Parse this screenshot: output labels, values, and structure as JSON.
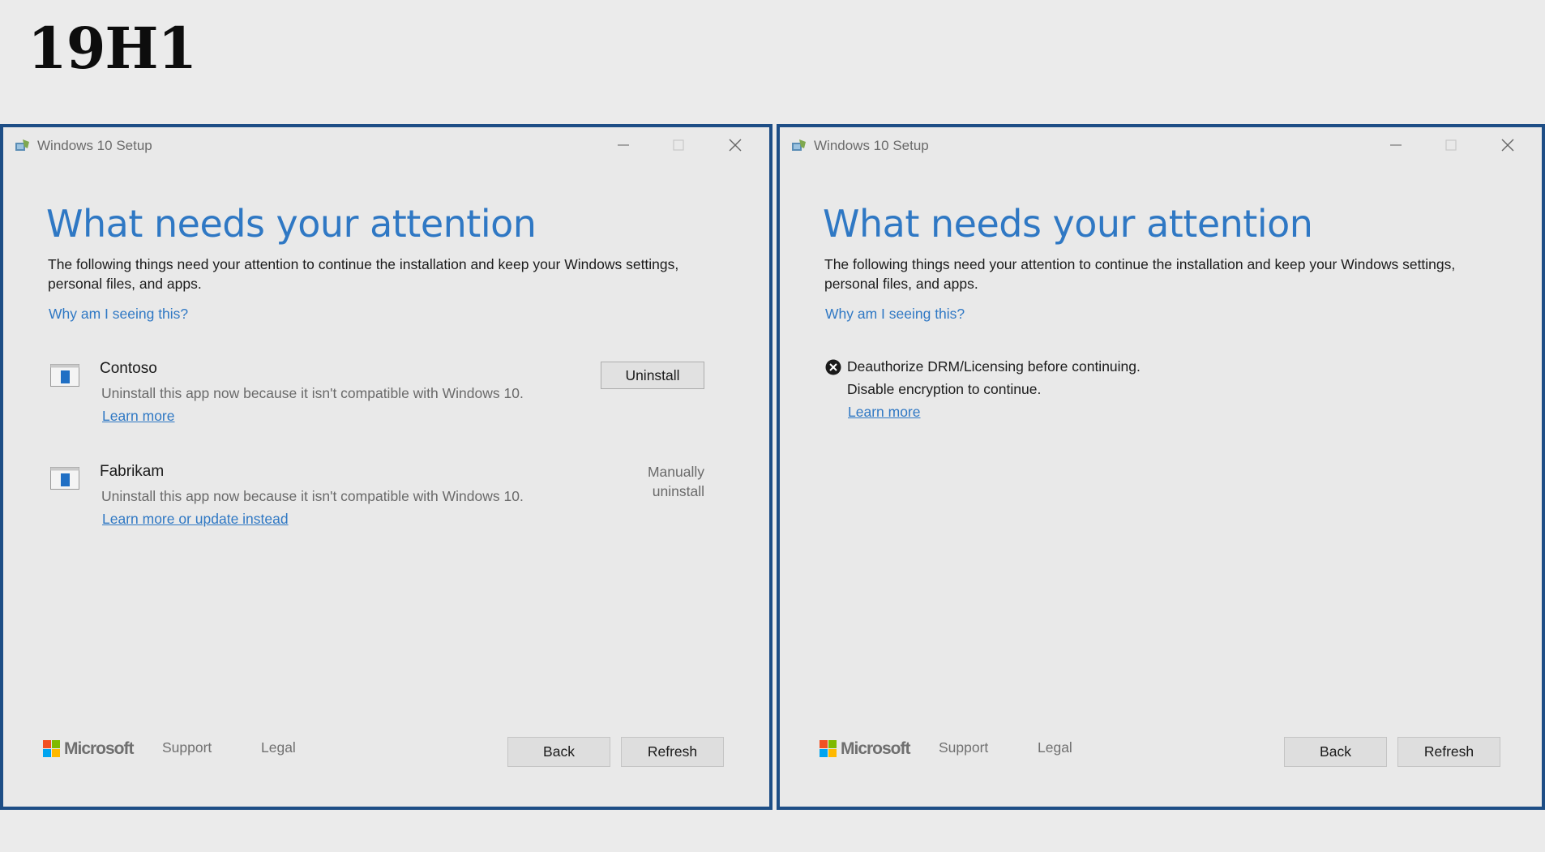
{
  "page_title": "19H1",
  "windows": [
    {
      "title": "Windows 10 Setup",
      "heading": "What needs your attention",
      "description": "The following things need your attention to continue the installation and keep your Windows settings, personal files, and apps.",
      "why_link": "Why am I seeing this?",
      "apps": [
        {
          "name": "Contoso",
          "message": "Uninstall this app now because it isn't compatible with Windows 10.",
          "link": "Learn more",
          "action_button": "Uninstall"
        },
        {
          "name": "Fabrikam",
          "message": "Uninstall this app now because it isn't compatible with Windows 10.",
          "link": "Learn more or update instead",
          "action_text": "Manually uninstall"
        }
      ],
      "footer": {
        "brand": "Microsoft",
        "support": "Support",
        "legal": "Legal",
        "back": "Back",
        "refresh": "Refresh"
      }
    },
    {
      "title": "Windows 10 Setup",
      "heading": "What needs your attention",
      "description": "The following things need your attention to continue the installation and keep your Windows settings, personal files, and apps.",
      "why_link": "Why am I seeing this?",
      "issue": {
        "line1": "Deauthorize DRM/Licensing before continuing.",
        "line2": "Disable encryption to continue.",
        "link": "Learn more"
      },
      "footer": {
        "brand": "Microsoft",
        "support": "Support",
        "legal": "Legal",
        "back": "Back",
        "refresh": "Refresh"
      }
    }
  ],
  "colors": {
    "accent_blue": "#2f78c4",
    "window_border": "#1e4e86",
    "background": "#ebebeb"
  }
}
